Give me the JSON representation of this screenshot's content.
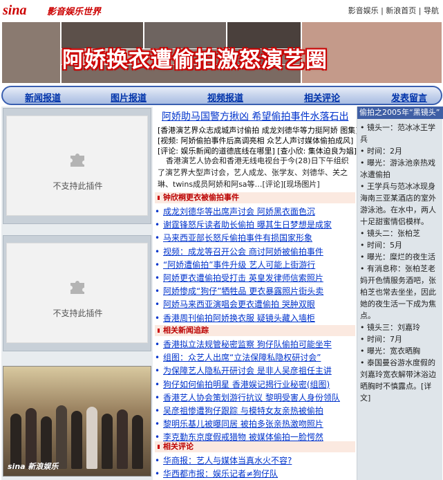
{
  "header": {
    "logo": "sina",
    "subtitle": "影音娱乐世界",
    "top_links": "影音娱乐 | 新浪首页 | 导航"
  },
  "banner": {
    "title": "阿娇换衣遭偷拍激怒演艺圈"
  },
  "nav": [
    "新闻报道",
    "图片报道",
    "视频报道",
    "相关评论",
    "发表留言"
  ],
  "plugins": [
    {
      "text": "不支持此插件"
    },
    {
      "text": "不支持此插件"
    }
  ],
  "photo_logo": "sina 新浪娱乐",
  "main": {
    "headline": "阿娇助马国警方揪凶  希望偷拍事件水落石出",
    "related": [
      "[香港演艺界众志成城声讨偷拍  成龙刘德华等力挺阿娇  图集]",
      "[视频:  阿娇偷拍事件后高调亮相  众艺人声讨媒体偷拍成风]",
      "[评论:  娱乐新闻的道德底线在哪里]  [查小欣:  集体迫良为娼]"
    ],
    "intro": "香港演艺人协会和香港无线电视台于今(28)日下午组织了演艺界大型声讨会，艺人成龙、张学友、刘德华、关之琳、twins成员阿娇和阿sa等…[评论][现场图片]",
    "sections": [
      {
        "title": "钟欣桐更衣被偷拍事件",
        "items": [
          "成龙刘德华等出席声讨会 阿娇黑衣面色沉",
          "谢霆锋怒斥读者助长偷拍 曝其生日梦想是成家",
          "马来西亚部长怒斥偷拍事件有损国家形象",
          "视频：成龙等召开公会 商讨阿娇被偷拍事件",
          "“阿娇遭偷拍”事件升级 艺人可能上街游行",
          "阿娇更衣遭偷拍受打击 英皇发律师信索照片",
          "阿娇惨成“狗仔”牺牲品 更衣暴露照片街头卖",
          "阿娇马来西亚演唱会更衣遭偷拍 哭肿双眼",
          "香港周刊偷拍阿娇换衣服 疑镜头藏入墙柜"
        ]
      },
      {
        "title": "相关新闻追踪",
        "items": [
          "香港拟立法规管秘密监察 狗仔队偷拍可能坐牢",
          "组图：众艺人出席“立法保障私隐权研讨会”",
          "为保障艺人隐私开研讨会 是非人吴彦祖任主讲",
          "狗仔如何偷拍明星 香港娱记揭行业秘密(组图)",
          "香港艺人协会策划游行抗议 黎明受害人身份领队",
          "吴彦祖惨遭狗仔跟踪 与模特女友亲热被偷拍",
          "黎明乐基儿被曝同居 被拍多张亲热激吻照片",
          "李克勤东京度假戒猎物 被媒体偷拍一脸愕然"
        ]
      },
      {
        "title": "相关评论",
        "items": [
          "华商报：艺人与媒体当真水火不容?",
          "华西都市报：娱乐记者≠狗仔队"
        ]
      }
    ]
  },
  "sidebar": {
    "title": "偷拍之2005年“黑镜头”",
    "lines": [
      "• 镜头一：范冰冰王学兵",
      "• 时间：2月",
      "• 曝光：游泳池亲热戏冰遭偷拍",
      "• 王学兵与范冰冰现身海南三亚某酒店的室外游泳池。在水中，两人十足甜蜜情侣模样。",
      "• 镜头二：张柏芝",
      "• 时间：5月",
      "• 曝光：糜烂的夜生活",
      "• 有消息称：张柏芝老妈开色情服务酒吧，张柏芝也常去坐坐，因此她的夜生活一下成为焦点。",
      "• 镜头三：刘嘉玲",
      "• 时间：7月",
      "• 曝光：宽衣晒胸",
      "• 泰国曼谷游水度假的刘嘉玲宽衣解带沐浴边晒胸时不慎露点。[详文]"
    ]
  }
}
